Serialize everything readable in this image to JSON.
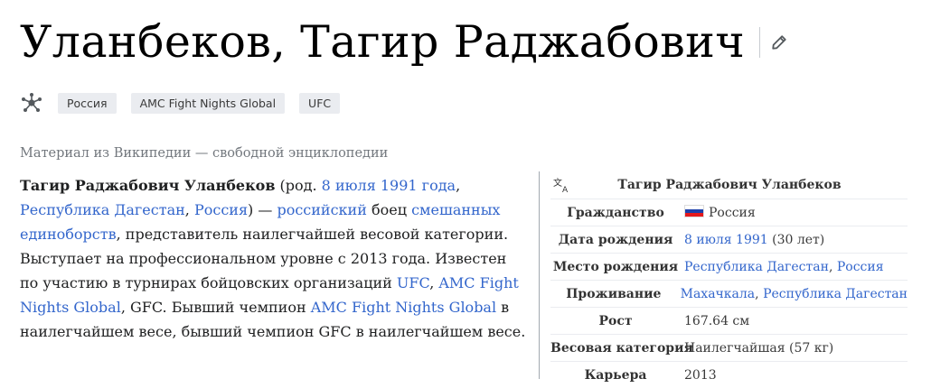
{
  "page": {
    "title": "Уланбеков, Тагир Раджабович",
    "tagline": "Материал из Википедии — свободной энциклопедии"
  },
  "icons": {
    "edit": "pencil-icon",
    "hub": "hub-network-icon",
    "language": "language-icon",
    "flag": "russia-flag-icon"
  },
  "colors": {
    "link": "#3366cc",
    "tag_bg": "#eaecf0",
    "tagline": "#72777d"
  },
  "tags": [
    "Россия",
    "AMC Fight Nights Global",
    "UFC"
  ],
  "lead": {
    "name": "Тагир Раджабович Уланбеков",
    "t1": " (род. ",
    "l1": "8 июля 1991 года",
    "t2": ", ",
    "l2": "Республика Дагестан",
    "t3": ", ",
    "l3": "Россия",
    "t4": ") — ",
    "l4": "российский",
    "t5": " боец ",
    "l5": "смешанных единоборств",
    "t6": ", представитель наилегчайшей весовой категории. Выступает на профессиональном уровне с 2013 года. Известен по участию в турнирах бойцовских организаций ",
    "l6": "UFC",
    "t7": ", ",
    "l7": "AMC Fight Nights Global",
    "t8": ", GFC. Бывший чемпион ",
    "l8": "AMC Fight Nights Global",
    "t9": " в наилегчайшем весе, бывший чемпион GFC в наилегчайшем весе."
  },
  "infobox": {
    "title": "Тагир Раджабович Уланбеков",
    "citizenship_label": "Гражданство",
    "citizenship_value": "Россия",
    "birthdate_label": "Дата рождения",
    "birthdate_link": "8 июля 1991",
    "birthdate_age": " (30 лет)",
    "birthplace_label": "Место рождения",
    "birthplace_link1": "Республика Дагестан",
    "birthplace_sep": ", ",
    "birthplace_link2": "Россия",
    "residence_label": "Проживание",
    "residence_link1": "Махачкала",
    "residence_sep": ", ",
    "residence_link2": "Республика Дагестан",
    "height_label": "Рост",
    "height_value": "167.64 см",
    "weight_label": "Весовая категория",
    "weight_value": "Наилегчайшая (57 кг)",
    "career_label": "Карьера",
    "career_value": "2013"
  }
}
